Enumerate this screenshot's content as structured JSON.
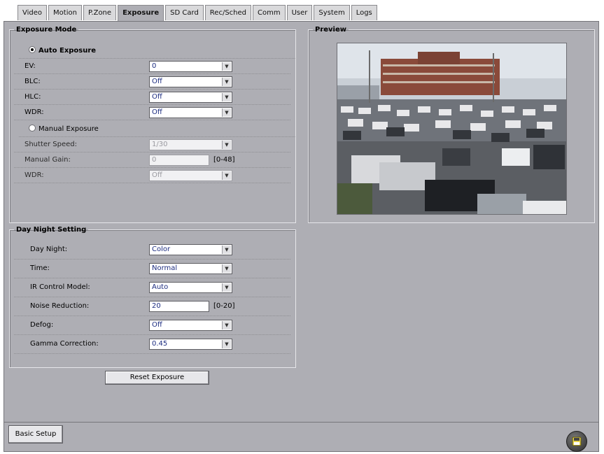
{
  "tabs": [
    "Video",
    "Motion",
    "P.Zone",
    "Exposure",
    "SD Card",
    "Rec/Sched",
    "Comm",
    "User",
    "System",
    "Logs"
  ],
  "active_tab": "Exposure",
  "exposure": {
    "legend": "Exposure Mode",
    "auto_label": "Auto Exposure",
    "ev_label": "EV:",
    "ev_value": "0",
    "blc_label": "BLC:",
    "blc_value": "Off",
    "hlc_label": "HLC:",
    "hlc_value": "Off",
    "wdr_label": "WDR:",
    "wdr_value": "Off",
    "manual_label": "Manual Exposure",
    "shutter_label": "Shutter Speed:",
    "shutter_value": "1/30",
    "gain_label": "Manual Gain:",
    "gain_value": "0",
    "gain_range": "[0-48]",
    "wdr2_label": "WDR:",
    "wdr2_value": "Off"
  },
  "daynight": {
    "legend": "Day Night Setting",
    "daynight_label": "Day Night:",
    "daynight_value": "Color",
    "time_label": "Time:",
    "time_value": "Normal",
    "ir_label": "IR Control Model:",
    "ir_value": "Auto",
    "noise_label": "Noise Reduction:",
    "noise_value": "20",
    "noise_range": "[0-20]",
    "defog_label": "Defog:",
    "defog_value": "Off",
    "gamma_label": "Gamma Correction:",
    "gamma_value": "0.45"
  },
  "preview": {
    "legend": "Preview"
  },
  "buttons": {
    "reset": "Reset Exposure",
    "basic_setup": "Basic Setup"
  },
  "icons": {
    "select_arrow": "chevron-down-icon",
    "save": "floppy-disk-icon"
  },
  "colors": {
    "panel": "#aeaeb4",
    "tab_active": "#aeaeb4",
    "field_text": "#1c2c80"
  }
}
